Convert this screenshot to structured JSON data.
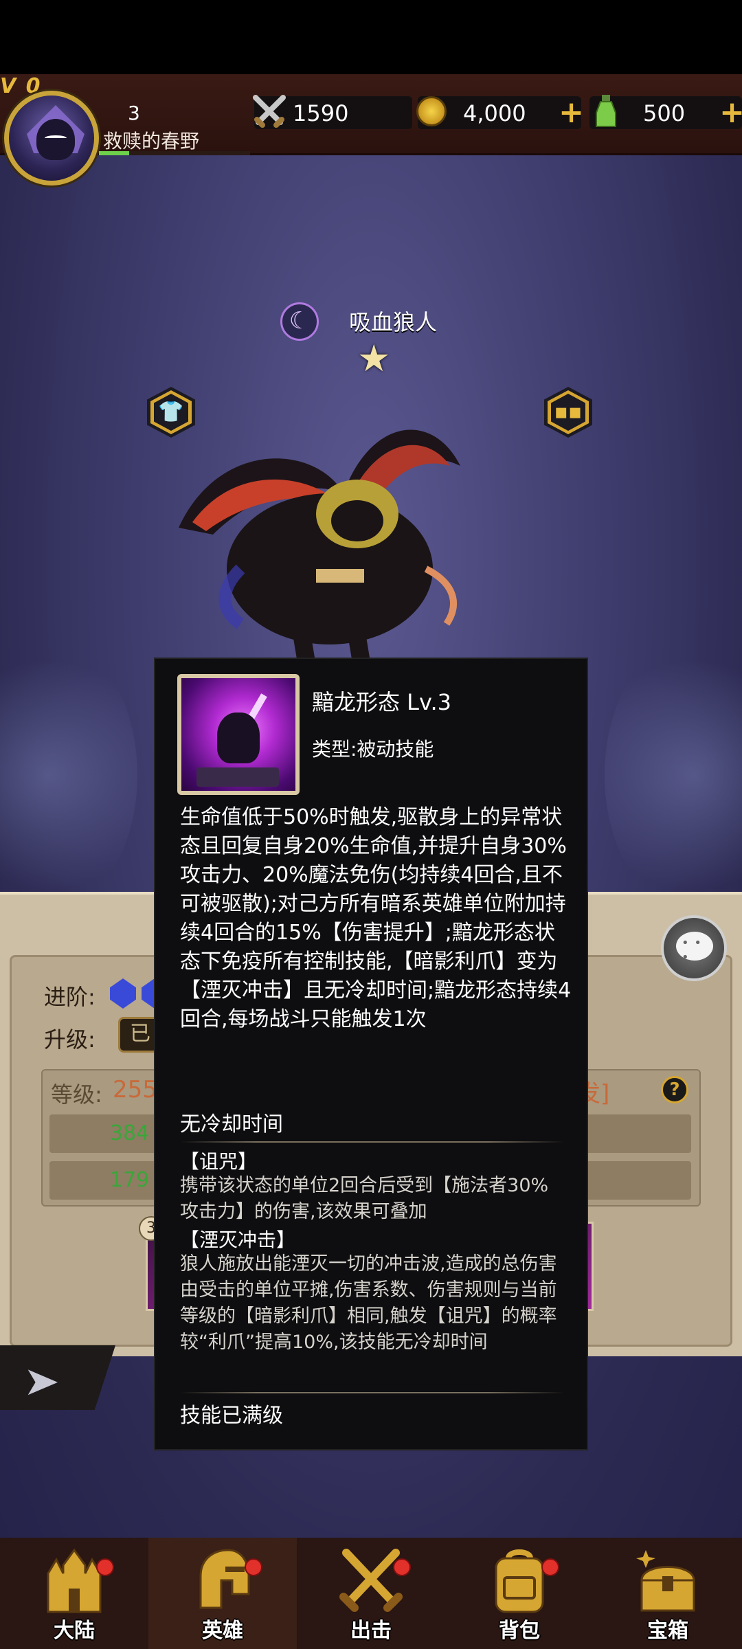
{
  "header": {
    "vip_label": "V 0",
    "player_level": "3",
    "player_name": "救赎的春野",
    "power": "1590",
    "coins": "4,000",
    "potions": "500",
    "add_symbol": "+"
  },
  "hero": {
    "name": "吸血狼人",
    "star": "★"
  },
  "panel": {
    "advance_label": "进阶:",
    "upgrade_label": "升级:",
    "upgrade_button": "已",
    "level_label": "等级:",
    "level_value": "255",
    "stat_attack": "384",
    "stat_defense": "179",
    "burst_label": "爆发]",
    "help_symbol": "?",
    "slot_badge": "3"
  },
  "tooltip": {
    "skill_name": "黯龙形态  Lv.3",
    "skill_type": "类型:被动技能",
    "description": "生命值低于50%时触发,驱散身上的异常状态且回复自身20%生命值,并提升自身30%攻击力、20%魔法免伤(均持续4回合,且不可被驱散);对己方所有暗系英雄单位附加持续4回合的15%【伤害提升】;黯龙形态状态下免疫所有控制技能,【暗影利爪】变为【湮灭冲击】且无冷却时间;黯龙形态持续4回合,每场战斗只能触发1次",
    "cooldown_label": "无冷却时间",
    "curse_title": "【诅咒】",
    "curse_text": "携带该状态的单位2回合后受到【施法者30%攻击力】的伤害,该效果可叠加",
    "annihilate_title": "【湮灭冲击】",
    "annihilate_text": "狼人施放出能湮灭一切的冲击波,造成的总伤害由受击的单位平摊,伤害系数、伤害规则与当前等级的【暗影利爪】相同,触发【诅咒】的概率较“利爪”提高10%,该技能无冷却时间",
    "max_level_label": "技能已满级"
  },
  "nav": {
    "items": [
      {
        "label": "大陆",
        "icon": "castle-icon"
      },
      {
        "label": "英雄",
        "icon": "helmet-icon"
      },
      {
        "label": "出击",
        "icon": "crossed-swords-icon"
      },
      {
        "label": "背包",
        "icon": "backpack-icon"
      },
      {
        "label": "宝箱",
        "icon": "treasure-chest-icon"
      }
    ],
    "active_index": 1
  },
  "colors": {
    "accent_gold": "#e6b93c",
    "badge_red": "#e2302a",
    "tooltip_bg": "#0e0e10",
    "scene_bg": "#3e3c6c"
  }
}
